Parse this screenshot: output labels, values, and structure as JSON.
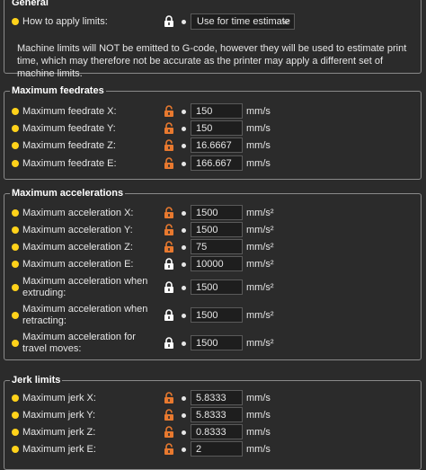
{
  "general": {
    "title": "General",
    "apply_label": "How to apply limits:",
    "apply_value": "Use for time estimate",
    "note": "Machine limits will NOT be emitted to G-code, however they will be used to estimate print time, which may therefore not be accurate as the printer may apply a different set of machine limits."
  },
  "feedrates": {
    "title": "Maximum feedrates",
    "rows": [
      {
        "label": "Maximum feedrate X:",
        "value": "150",
        "unit": "mm/s",
        "lock": "unlocked-lock-icon"
      },
      {
        "label": "Maximum feedrate Y:",
        "value": "150",
        "unit": "mm/s",
        "lock": "unlocked-lock-icon"
      },
      {
        "label": "Maximum feedrate Z:",
        "value": "16.6667",
        "unit": "mm/s",
        "lock": "unlocked-lock-icon"
      },
      {
        "label": "Maximum feedrate E:",
        "value": "166.667",
        "unit": "mm/s",
        "lock": "unlocked-lock-icon"
      }
    ]
  },
  "accelerations": {
    "title": "Maximum accelerations",
    "rows": [
      {
        "label": "Maximum acceleration X:",
        "value": "1500",
        "unit": "mm/s²",
        "lock": "unlocked-lock-icon"
      },
      {
        "label": "Maximum acceleration Y:",
        "value": "1500",
        "unit": "mm/s²",
        "lock": "unlocked-lock-icon"
      },
      {
        "label": "Maximum acceleration Z:",
        "value": "75",
        "unit": "mm/s²",
        "lock": "unlocked-lock-icon"
      },
      {
        "label": "Maximum acceleration E:",
        "value": "10000",
        "unit": "mm/s²",
        "lock": "locked-lock-icon"
      },
      {
        "label": "Maximum acceleration when extruding:",
        "value": "1500",
        "unit": "mm/s²",
        "lock": "locked-lock-icon"
      },
      {
        "label": "Maximum acceleration when retracting:",
        "value": "1500",
        "unit": "mm/s²",
        "lock": "locked-lock-icon"
      },
      {
        "label": "Maximum acceleration for travel moves:",
        "value": "1500",
        "unit": "mm/s²",
        "lock": "locked-lock-icon"
      }
    ]
  },
  "jerk": {
    "title": "Jerk limits",
    "rows": [
      {
        "label": "Maximum jerk X:",
        "value": "5.8333",
        "unit": "mm/s",
        "lock": "unlocked-lock-icon"
      },
      {
        "label": "Maximum jerk Y:",
        "value": "5.8333",
        "unit": "mm/s",
        "lock": "unlocked-lock-icon"
      },
      {
        "label": "Maximum jerk Z:",
        "value": "0.8333",
        "unit": "mm/s",
        "lock": "unlocked-lock-icon"
      },
      {
        "label": "Maximum jerk E:",
        "value": "2",
        "unit": "mm/s",
        "lock": "unlocked-lock-icon"
      }
    ]
  },
  "colors": {
    "dot": "#ffd21a",
    "unlocked": "#e8792f",
    "locked": "#ffffff"
  }
}
